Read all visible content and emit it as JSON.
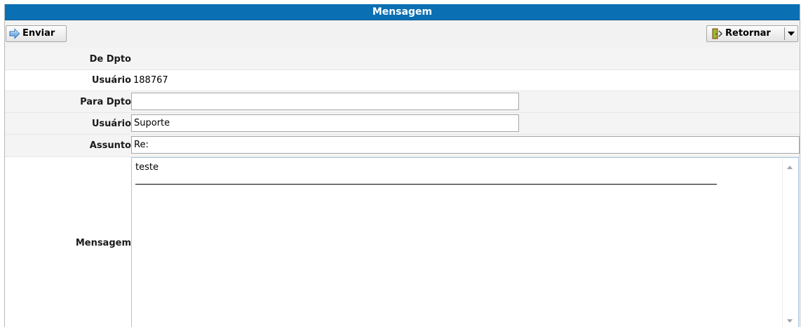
{
  "window": {
    "title": "Mensagem"
  },
  "toolbar": {
    "send_label": "Enviar",
    "send_icon": "arrow-right-icon",
    "return_label": "Retornar",
    "return_icon": "exit-door-icon"
  },
  "form": {
    "from_dept_label": "De Dpto",
    "from_dept_value": "",
    "from_user_label": "Usuário",
    "from_user_value": "188767",
    "to_dept_label": "Para Dpto",
    "to_dept_value": "",
    "to_user_label": "Usuário",
    "to_user_value": "Suporte",
    "subject_label": "Assunto",
    "subject_value": "Re:",
    "message_label": "Mensagem",
    "message_value": "teste"
  },
  "colors": {
    "title_bar": "#0b6fb3",
    "toolbar_bg": "#f2f2f2",
    "row_shade": "#f4f4f4"
  }
}
